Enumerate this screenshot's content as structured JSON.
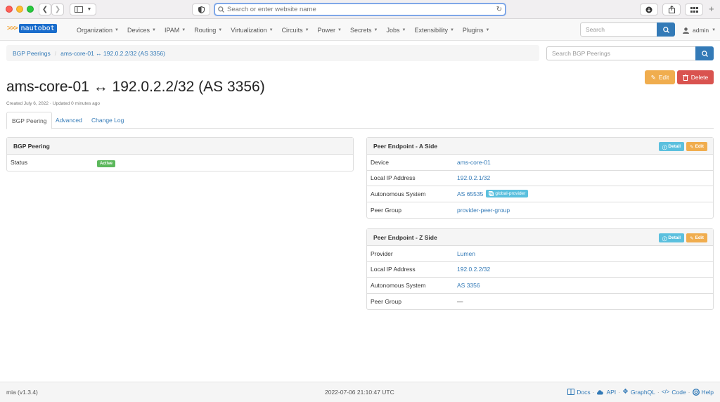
{
  "browser": {
    "url_placeholder": "Search or enter website name"
  },
  "navbar": {
    "logo_text": "nautobot",
    "menu": [
      "Organization",
      "Devices",
      "IPAM",
      "Routing",
      "Virtualization",
      "Circuits",
      "Power",
      "Secrets",
      "Jobs",
      "Extensibility",
      "Plugins"
    ],
    "search_placeholder": "Search",
    "user": "admin"
  },
  "breadcrumb": {
    "items": [
      "BGP Peerings",
      "ams-core-01 ↔ 192.0.2.2/32 (AS 3356)"
    ],
    "search_placeholder": "Search BGP Peerings"
  },
  "actions": {
    "edit": "Edit",
    "delete": "Delete"
  },
  "page": {
    "title": "ams-core-01 ↔ 192.0.2.2/32 (AS 3356)",
    "subtitle": "Created July 6, 2022 · Updated 0 minutes ago"
  },
  "tabs": [
    "BGP Peering",
    "Advanced",
    "Change Log"
  ],
  "bgp_panel": {
    "title": "BGP Peering",
    "status_label": "Status",
    "status_value": "Active",
    "status_color": "#5cb85c"
  },
  "endpoint_a": {
    "title": "Peer Endpoint - A Side",
    "detail": "Detail",
    "edit": "Edit",
    "rows": [
      {
        "k": "Device",
        "v": "ams-core-01"
      },
      {
        "k": "Local IP Address",
        "v": "192.0.2.1/32"
      },
      {
        "k": "Autonomous System",
        "v": "AS 65535",
        "tag": "global-provider"
      },
      {
        "k": "Peer Group",
        "v": "provider-peer-group"
      }
    ]
  },
  "endpoint_z": {
    "title": "Peer Endpoint - Z Side",
    "detail": "Detail",
    "edit": "Edit",
    "rows": [
      {
        "k": "Provider",
        "v": "Lumen"
      },
      {
        "k": "Local IP Address",
        "v": "192.0.2.2/32"
      },
      {
        "k": "Autonomous System",
        "v": "AS 3356"
      },
      {
        "k": "Peer Group",
        "v": "—"
      }
    ]
  },
  "footer": {
    "version": "mia (v1.3.4)",
    "timestamp": "2022-07-06 21:10:47 UTC",
    "links": [
      "Docs",
      "API",
      "GraphQL",
      "Code",
      "Help"
    ]
  }
}
